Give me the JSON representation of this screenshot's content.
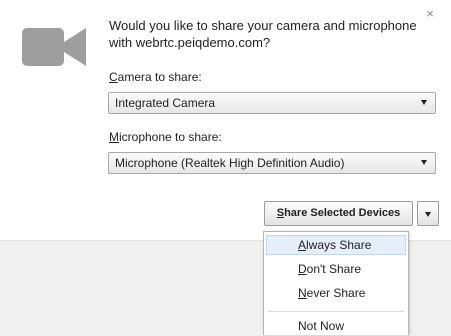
{
  "colors": {
    "icon_gray": "#9e9e9e",
    "background": "#ffffff",
    "bottom_band": "#f0f0f0",
    "menu_highlight": "#e5eefb"
  },
  "icons": {
    "camera": "video-camera-icon",
    "close": "close-icon",
    "select_arrow": "chevron-down-icon"
  },
  "prompt": {
    "line1": "Would you like to share your camera and microphone",
    "line2": "with webrtc.peiqdemo.com?"
  },
  "camera": {
    "label_mnemonic": "C",
    "label_rest": "amera to share:",
    "selected": "Integrated Camera"
  },
  "microphone": {
    "label_mnemonic": "M",
    "label_rest": "icrophone to share:",
    "selected": "Microphone (Realtek High Definition Audio)"
  },
  "share_button": {
    "mnemonic": "S",
    "rest": "hare Selected Devices"
  },
  "menu": {
    "items": [
      {
        "mnemonic": "A",
        "rest": "lways Share"
      },
      {
        "mnemonic": "D",
        "rest": "on't Share"
      },
      {
        "mnemonic": "N",
        "rest": "ever Share"
      },
      {
        "mnemonic": "",
        "rest": "Not Now"
      }
    ]
  }
}
